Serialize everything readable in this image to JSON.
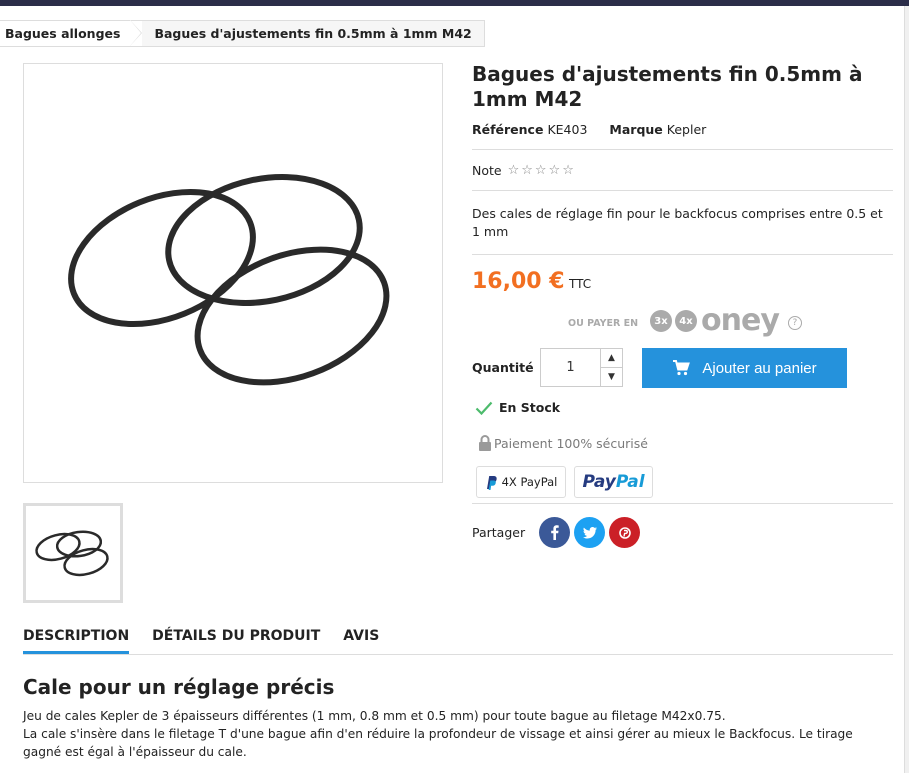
{
  "breadcrumb": {
    "items": [
      "Bagues allonges",
      "Bagues d'ajustements fin 0.5mm à 1mm M42"
    ]
  },
  "product": {
    "title": "Bagues d'ajustements fin 0.5mm à 1mm M42",
    "reference_label": "Référence",
    "reference_value": "KE403",
    "brand_label": "Marque",
    "brand_value": "Kepler",
    "rating_label": "Note",
    "rating_stars": "☆☆☆☆☆",
    "short_description": "Des cales de réglage fin pour le backfocus comprises entre 0.5 et 1 mm",
    "price": "16,00 €",
    "tax_label": "TTC",
    "oney_label": "OU PAYER EN",
    "oney_3x": "3x",
    "oney_4x": "4x",
    "oney_brand": "oney",
    "quantity_label": "Quantité",
    "quantity_value": "1",
    "add_to_cart": "Ajouter au panier",
    "stock": "En Stock",
    "secure_payment": "Paiement 100% sécurisé",
    "paypal_4x": "4X PayPal",
    "paypal_pay": "Pay",
    "paypal_pal": "Pal",
    "share_label": "Partager"
  },
  "social": [
    {
      "name": "facebook",
      "glyph": "f",
      "color": "#3b5998"
    },
    {
      "name": "twitter",
      "glyph": "t",
      "color": "#1da1f2"
    },
    {
      "name": "pinterest",
      "glyph": "p",
      "color": "#cb2027"
    }
  ],
  "tabs": [
    "DESCRIPTION",
    "DÉTAILS DU PRODUIT",
    "AVIS"
  ],
  "description": {
    "title": "Cale pour un réglage précis",
    "line1": "Jeu de cales Kepler de 3 épaisseurs différentes (1 mm, 0.8 mm et 0.5 mm) pour toute bague au filetage M42x0.75.",
    "line2": "La cale s'insère dans le filetage T d'une bague afin d'en réduire la profondeur de vissage et ainsi gérer au mieux le Backfocus. Le tirage gagné est égal à l'épaisseur du cale."
  },
  "colors": {
    "accent": "#2592dc",
    "price": "#f26f21",
    "stock_check": "#4cbb6c",
    "topbar": "#2b2d49"
  }
}
